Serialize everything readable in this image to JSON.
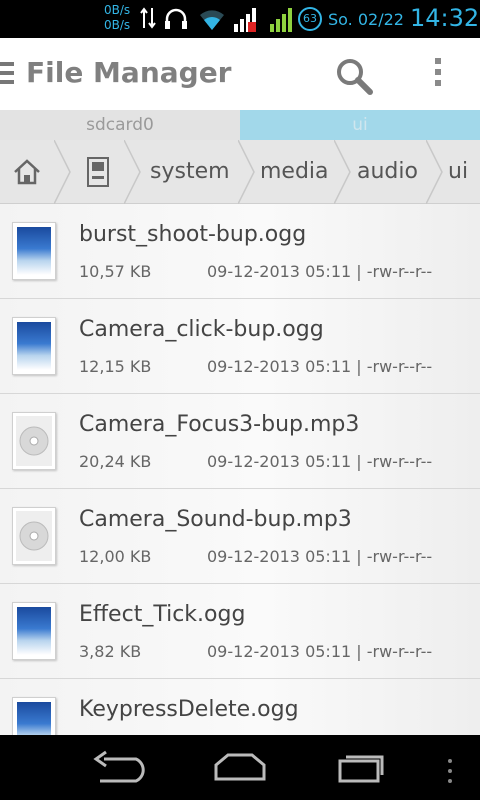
{
  "status": {
    "net_up": "0B/s",
    "net_down": "0B/s",
    "battery": "63",
    "date": "So. 02/22",
    "time": "14:32"
  },
  "app": {
    "title": "File Manager"
  },
  "tabs": [
    {
      "label": "sdcard0"
    },
    {
      "label": "ui"
    }
  ],
  "breadcrumb": [
    "system",
    "media",
    "audio",
    "ui"
  ],
  "files": [
    {
      "name": "burst_shoot-bup.ogg",
      "size": "10,57 KB",
      "meta": "09-12-2013 05:11 | -rw-r--r--",
      "icon": "ogg-image-icon"
    },
    {
      "name": "Camera_click-bup.ogg",
      "size": "12,15 KB",
      "meta": "09-12-2013 05:11 | -rw-r--r--",
      "icon": "ogg-image-icon"
    },
    {
      "name": "Camera_Focus3-bup.mp3",
      "size": "20,24 KB",
      "meta": "09-12-2013 05:11 | -rw-r--r--",
      "icon": "cd-disc-icon"
    },
    {
      "name": "Camera_Sound-bup.mp3",
      "size": "12,00 KB",
      "meta": "09-12-2013 05:11 | -rw-r--r--",
      "icon": "cd-disc-icon"
    },
    {
      "name": "Effect_Tick.ogg",
      "size": "3,82 KB",
      "meta": "09-12-2013 05:11 | -rw-r--r--",
      "icon": "ogg-image-icon"
    },
    {
      "name": "KeypressDelete.ogg",
      "size": "",
      "meta": "",
      "icon": "ogg-image-icon"
    }
  ],
  "colors": {
    "accent": "#33b5e5",
    "active_tab": "#a2d8ea"
  }
}
